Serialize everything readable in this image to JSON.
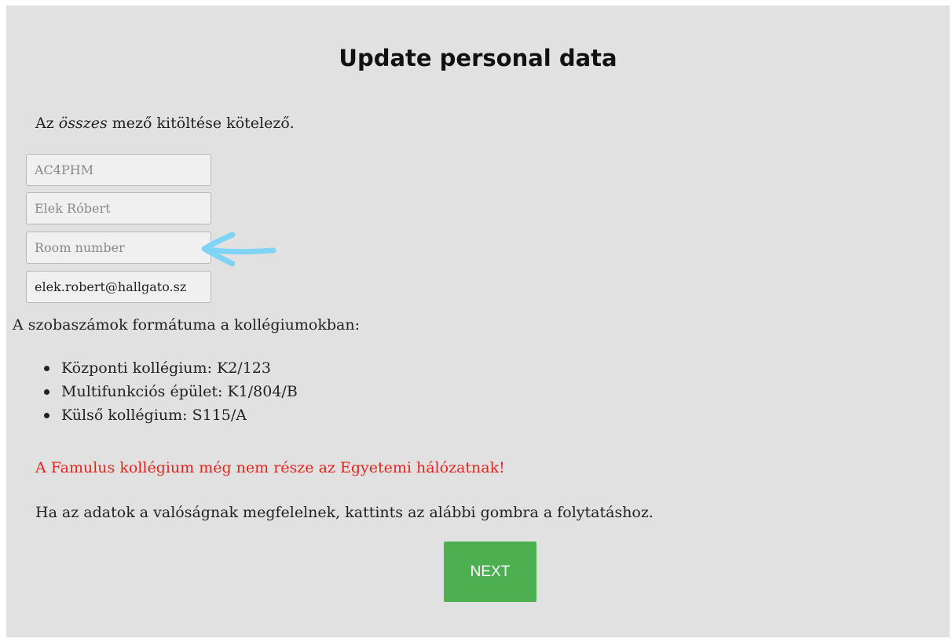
{
  "page": {
    "title": "Update personal data"
  },
  "form": {
    "required_note_prefix": "Az ",
    "required_note_emphasis": "összes",
    "required_note_suffix": " mező kitöltése kötelező.",
    "fields": [
      {
        "name": "neptun-code",
        "value": "AC4PHM",
        "placeholder": ""
      },
      {
        "name": "full-name",
        "value": "Elek Róbert",
        "placeholder": ""
      },
      {
        "name": "room-number",
        "value": "",
        "placeholder": "Room number"
      },
      {
        "name": "email",
        "value": "elek.robert@hallgato.sz",
        "placeholder": ""
      }
    ]
  },
  "room_format": {
    "heading": "A szobaszámok formátuma a kollégiumokban:",
    "items": [
      "Központi kollégium: K2/123",
      "Multifunkciós épület: K1/804/B",
      "Külső kollégium: S115/A"
    ]
  },
  "warning": "A Famulus kollégium még nem része az Egyetemi hálózatnak!",
  "confirm_text": "Ha az adatok a valóságnak megfelelnek, kattints az alábbi gombra a folytatáshoz.",
  "next_button": "NEXT",
  "colors": {
    "panel_bg": "#e1e1e1",
    "warning": "#e8231c",
    "button": "#4caf50",
    "arrow": "#7fd3f5"
  },
  "icons": {
    "annotation_arrow": "left-arrow-icon"
  }
}
